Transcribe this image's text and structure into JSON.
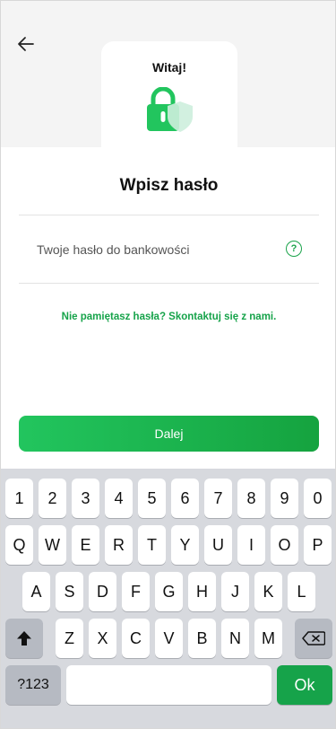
{
  "header": {
    "back_icon": "arrow-left-icon"
  },
  "welcome": {
    "title": "Witaj!",
    "icon": "lock-shield-icon"
  },
  "page": {
    "heading": "Wpisz hasło"
  },
  "password": {
    "label": "Twoje hasło do bankowości",
    "help_icon": "?"
  },
  "forgot": {
    "text": "Nie pamiętasz hasła? Skontaktuj się z nami."
  },
  "next_button": {
    "label": "Dalej"
  },
  "keyboard": {
    "row1": [
      "1",
      "2",
      "3",
      "4",
      "5",
      "6",
      "7",
      "8",
      "9",
      "0"
    ],
    "row2": [
      "Q",
      "W",
      "E",
      "R",
      "T",
      "Y",
      "U",
      "I",
      "O",
      "P"
    ],
    "row3": [
      "A",
      "S",
      "D",
      "F",
      "G",
      "H",
      "J",
      "K",
      "L"
    ],
    "row4": [
      "Z",
      "X",
      "C",
      "V",
      "B",
      "N",
      "M"
    ],
    "shift_icon": "shift-icon",
    "backspace_icon": "backspace-icon",
    "symbols_label": "?123",
    "ok_label": "Ok"
  },
  "colors": {
    "accent": "#16a34a",
    "accent_light": "#22c55e",
    "top_band": "#f4f4f4",
    "keyboard_bg": "#d7d9de"
  }
}
